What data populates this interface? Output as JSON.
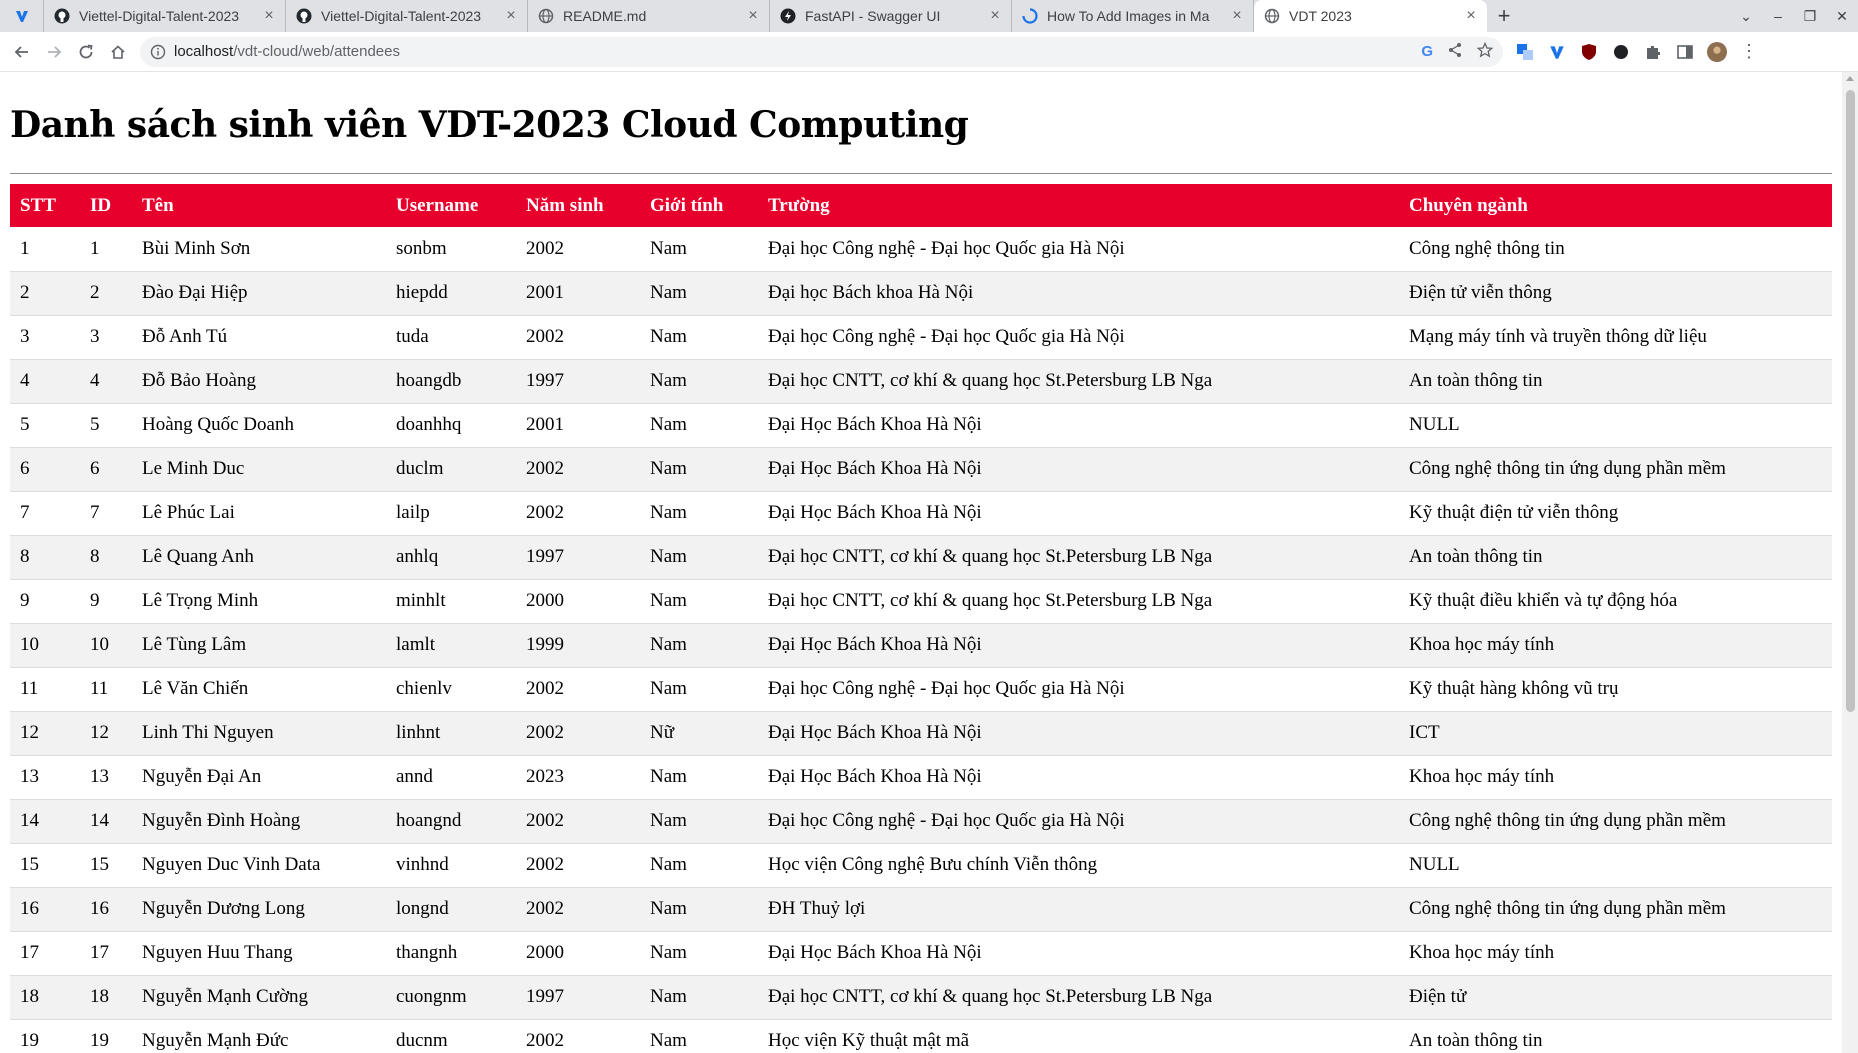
{
  "browser": {
    "tabs": [
      {
        "title": "Viettel-Digital-Talent-2023",
        "icon": "viettel-icon",
        "active": false
      },
      {
        "title": "Viettel-Digital-Talent-2023",
        "icon": "github-icon",
        "active": false
      },
      {
        "title": "Viettel-Digital-Talent-2023",
        "icon": "github-icon",
        "active": false
      },
      {
        "title": "README.md",
        "icon": "globe-icon",
        "active": false
      },
      {
        "title": "FastAPI - Swagger UI",
        "icon": "fastapi-icon",
        "active": false
      },
      {
        "title": "How To Add Images in Ma",
        "icon": "loading-icon",
        "active": false
      },
      {
        "title": "VDT 2023",
        "icon": "globe-icon",
        "active": true
      }
    ],
    "address": {
      "host": "localhost",
      "path": "/vdt-cloud/web/attendees"
    }
  },
  "page": {
    "title": "Danh sách sinh viên VDT-2023 Cloud Computing",
    "table": {
      "headers": [
        "STT",
        "ID",
        "Tên",
        "Username",
        "Năm sinh",
        "Giới tính",
        "Trường",
        "Chuyên ngành"
      ],
      "rows": [
        [
          "1",
          "1",
          "Bùi Minh Sơn",
          "sonbm",
          "2002",
          "Nam",
          "Đại học Công nghệ - Đại học Quốc gia Hà Nội",
          "Công nghệ thông tin"
        ],
        [
          "2",
          "2",
          "Đào Đại Hiệp",
          "hiepdd",
          "2001",
          "Nam",
          "Đại học Bách khoa Hà Nội",
          "Điện tử viễn thông"
        ],
        [
          "3",
          "3",
          "Đỗ Anh Tú",
          "tuda",
          "2002",
          "Nam",
          "Đại học Công nghệ - Đại học Quốc gia Hà Nội",
          "Mạng máy tính và truyền thông dữ liệu"
        ],
        [
          "4",
          "4",
          "Đỗ Bảo Hoàng",
          "hoangdb",
          "1997",
          "Nam",
          "Đại học CNTT, cơ khí & quang học St.Petersburg LB Nga",
          "An toàn thông tin"
        ],
        [
          "5",
          "5",
          "Hoàng Quốc Doanh",
          "doanhhq",
          "2001",
          "Nam",
          "Đại Học Bách Khoa Hà Nội",
          "NULL"
        ],
        [
          "6",
          "6",
          "Le Minh Duc",
          "duclm",
          "2002",
          "Nam",
          "Đại Học Bách Khoa Hà Nội",
          "Công nghệ thông tin ứng dụng phần mềm"
        ],
        [
          "7",
          "7",
          "Lê Phúc Lai",
          "lailp",
          "2002",
          "Nam",
          "Đại Học Bách Khoa Hà Nội",
          "Kỹ thuật điện tử viễn thông"
        ],
        [
          "8",
          "8",
          "Lê Quang Anh",
          "anhlq",
          "1997",
          "Nam",
          "Đại học CNTT, cơ khí & quang học St.Petersburg LB Nga",
          "An toàn thông tin"
        ],
        [
          "9",
          "9",
          "Lê Trọng Minh",
          "minhlt",
          "2000",
          "Nam",
          "Đại học CNTT, cơ khí & quang học St.Petersburg LB Nga",
          "Kỹ thuật điều khiển và tự động hóa"
        ],
        [
          "10",
          "10",
          "Lê Tùng Lâm",
          "lamlt",
          "1999",
          "Nam",
          "Đại Học Bách Khoa Hà Nội",
          "Khoa học máy tính"
        ],
        [
          "11",
          "11",
          "Lê Văn Chiến",
          "chienlv",
          "2002",
          "Nam",
          "Đại học Công nghệ - Đại học Quốc gia Hà Nội",
          "Kỹ thuật hàng không vũ trụ"
        ],
        [
          "12",
          "12",
          "Linh Thi Nguyen",
          "linhnt",
          "2002",
          "Nữ",
          "Đại Học Bách Khoa Hà Nội",
          "ICT"
        ],
        [
          "13",
          "13",
          "Nguyễn Đại An",
          "annd",
          "2023",
          "Nam",
          "Đại Học Bách Khoa Hà Nội",
          "Khoa học máy tính"
        ],
        [
          "14",
          "14",
          "Nguyễn Đình Hoàng",
          "hoangnd",
          "2002",
          "Nam",
          "Đại học Công nghệ - Đại học Quốc gia Hà Nội",
          "Công nghệ thông tin ứng dụng phần mềm"
        ],
        [
          "15",
          "15",
          "Nguyen Duc Vinh Data",
          "vinhnd",
          "2002",
          "Nam",
          "Học viện Công nghệ Bưu chính Viễn thông",
          "NULL"
        ],
        [
          "16",
          "16",
          "Nguyễn Dương Long",
          "longnd",
          "2002",
          "Nam",
          "ĐH Thuỷ lợi",
          "Công nghệ thông tin ứng dụng phần mềm"
        ],
        [
          "17",
          "17",
          "Nguyen Huu Thang",
          "thangnh",
          "2000",
          "Nam",
          "Đại Học Bách Khoa Hà Nội",
          "Khoa học máy tính"
        ],
        [
          "18",
          "18",
          "Nguyễn Mạnh Cường",
          "cuongnm",
          "1997",
          "Nam",
          "Đại học CNTT, cơ khí & quang học St.Petersburg LB Nga",
          "Điện tử"
        ],
        [
          "19",
          "19",
          "Nguyễn Mạnh Đức",
          "ducnm",
          "2002",
          "Nam",
          "Học viện Kỹ thuật mật mã",
          "An toàn thông tin"
        ]
      ]
    }
  },
  "colors": {
    "header_bg": "#e8002d",
    "header_text": "#ffffff",
    "row_alt": "#f2f2f2"
  }
}
